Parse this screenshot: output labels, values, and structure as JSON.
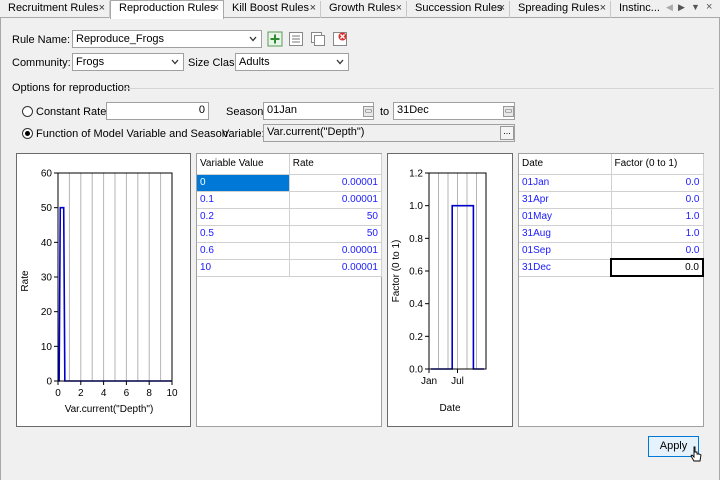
{
  "tabs": [
    {
      "label": "Recruitment Rules",
      "active": false
    },
    {
      "label": "Reproduction Rules",
      "active": true
    },
    {
      "label": "Kill Boost Rules",
      "active": false
    },
    {
      "label": "Growth Rules",
      "active": false
    },
    {
      "label": "Succession Rules",
      "active": false
    },
    {
      "label": "Spreading Rules",
      "active": false
    },
    {
      "label": "Instinc...",
      "active": false
    }
  ],
  "tab_close_glyph": "×",
  "tab_nav": {
    "left": "◀",
    "right": "▶",
    "menu": "▼"
  },
  "form": {
    "rule_name_label": "Rule Name:",
    "rule_name_value": "Reproduce_Frogs",
    "community_label": "Community:",
    "community_value": "Frogs",
    "size_class_label": "Size Class:",
    "size_class_value": "Adults",
    "toolbar_icons": [
      "add-rule-icon",
      "list-icon",
      "copy-icon",
      "delete-rule-icon"
    ]
  },
  "options": {
    "title": "Options for reproduction",
    "constant_rate_label": "Constant Rate:",
    "constant_rate_value": "0",
    "season_label": "Season:",
    "season_from": "01Jan",
    "season_to_label": "to",
    "season_to": "31Dec",
    "function_label": "Function of Model Variable and Season",
    "variable_label": "Variable:",
    "variable_value": "Var.current(\"Depth\")",
    "dots_label": "...",
    "selected_option": "function"
  },
  "rate_table": {
    "headers": [
      "Variable Value",
      "Rate"
    ],
    "rows": [
      [
        "0",
        "0.00001"
      ],
      [
        "0.1",
        "0.00001"
      ],
      [
        "0.2",
        "50"
      ],
      [
        "0.5",
        "50"
      ],
      [
        "0.6",
        "0.00001"
      ],
      [
        "10",
        "0.00001"
      ]
    ]
  },
  "factor_table": {
    "headers": [
      "Date",
      "Factor (0 to 1)"
    ],
    "rows": [
      [
        "01Jan",
        "0.0"
      ],
      [
        "31Apr",
        "0.0"
      ],
      [
        "01May",
        "1.0"
      ],
      [
        "31Aug",
        "1.0"
      ],
      [
        "01Sep",
        "0.0"
      ],
      [
        "31Dec",
        "0.0"
      ]
    ]
  },
  "apply_label": "Apply",
  "colors": {
    "series": "#0000cc",
    "selection": "#0078d7",
    "grid_text": "#1a1aff"
  },
  "chart_data": [
    {
      "type": "line",
      "xlabel": "Var.current(\"Depth\")",
      "ylabel": "Rate",
      "xlim": [
        0,
        10
      ],
      "ylim": [
        0,
        60
      ],
      "xticks": [
        "0",
        "2",
        "4",
        "6",
        "8",
        "10"
      ],
      "yticks": [
        "0",
        "10",
        "20",
        "30",
        "40",
        "50",
        "60"
      ],
      "x": [
        0,
        0.1,
        0.2,
        0.5,
        0.6,
        10
      ],
      "series": [
        {
          "values": [
            1e-05,
            1e-05,
            50,
            50,
            1e-05,
            1e-05
          ]
        }
      ],
      "grid": true
    },
    {
      "type": "line",
      "xlabel": "Date",
      "ylabel": "Factor (0 to 1)",
      "ylim": [
        0,
        1.2
      ],
      "xticks": [
        "Jan",
        "Jul"
      ],
      "yticks": [
        "0.0",
        "0.2",
        "0.4",
        "0.6",
        "0.8",
        "1.0",
        "1.2"
      ],
      "x": [
        "01Jan",
        "31Apr",
        "01May",
        "31Aug",
        "01Sep",
        "31Dec"
      ],
      "series": [
        {
          "values": [
            0.0,
            0.0,
            1.0,
            1.0,
            0.0,
            0.0
          ]
        }
      ],
      "grid": true
    }
  ]
}
